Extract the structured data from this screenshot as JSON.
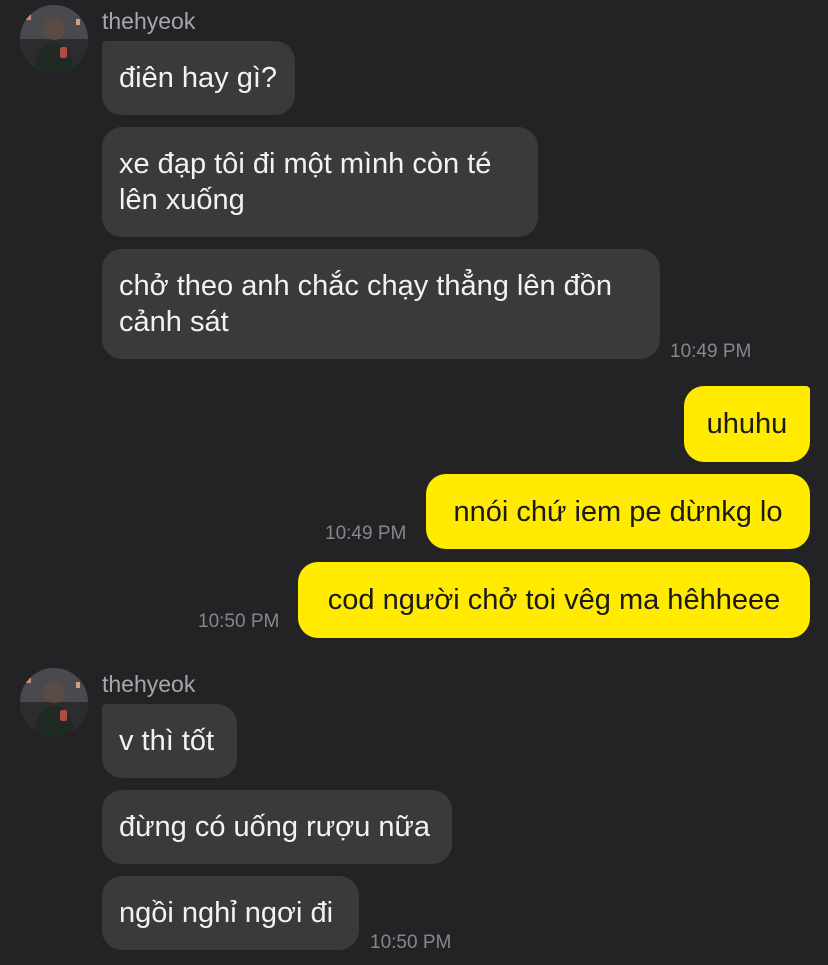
{
  "groups": [
    {
      "sender": "thehyeok",
      "messages": [
        "điên hay gì?",
        "xe đạp tôi đi một mình còn té lên xuống",
        "chở theo anh chắc chạy thẳng lên đồn cảnh sát"
      ],
      "time": "10:49 PM"
    },
    {
      "sender": "me",
      "messages": [
        {
          "text": "uhuhu",
          "time": ""
        },
        {
          "text": "nnói chứ iem pe dừnkg lo",
          "time": "10:49 PM"
        },
        {
          "text": "cod người chở toi vêg ma hêhheee",
          "time": "10:50 PM"
        }
      ]
    },
    {
      "sender": "thehyeok",
      "messages": [
        "v thì tốt",
        "đừng có uống rượu nữa",
        "ngồi nghỉ ngơi đi"
      ],
      "time": "10:50 PM"
    }
  ],
  "colors": {
    "background": "#232326",
    "incoming_bubble": "#3a3a3d",
    "outgoing_bubble": "#ffea00",
    "sender_name": "#a7a7ab",
    "timestamp": "#86868b"
  },
  "icons": {
    "avatar": "profile-photo-avatar"
  }
}
